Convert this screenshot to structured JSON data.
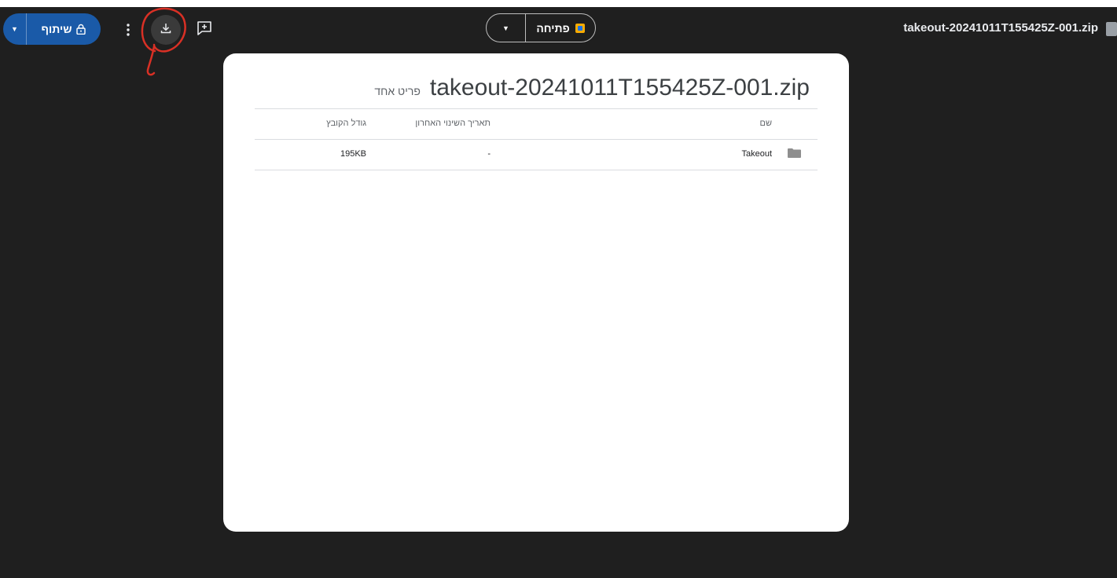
{
  "topbar": {
    "share_label": "שיתוף",
    "open_label": "פתיחה",
    "file_title": "takeout-20241011T155425Z-001.zip",
    "icons": {
      "share_caret": "caret-down-icon",
      "lock": "lock-icon",
      "more": "more-vert-icon",
      "download": "download-icon",
      "add_comment": "add-comment-icon",
      "open_caret": "caret-down-icon",
      "app": "app-icon",
      "file_type": "file-type-icon"
    },
    "colors": {
      "share_bg": "#1a5aa8",
      "annotation": "#d93025"
    }
  },
  "archive": {
    "name": "takeout-20241011T155425Z-001.zip",
    "item_count": "פריט אחד",
    "columns": {
      "name": "שם",
      "modified": "תאריך השינוי האחרון",
      "size": "גודל הקובץ"
    },
    "rows": [
      {
        "name": "Takeout",
        "modified": "-",
        "size": "195KB",
        "icon": "folder-icon"
      }
    ]
  }
}
